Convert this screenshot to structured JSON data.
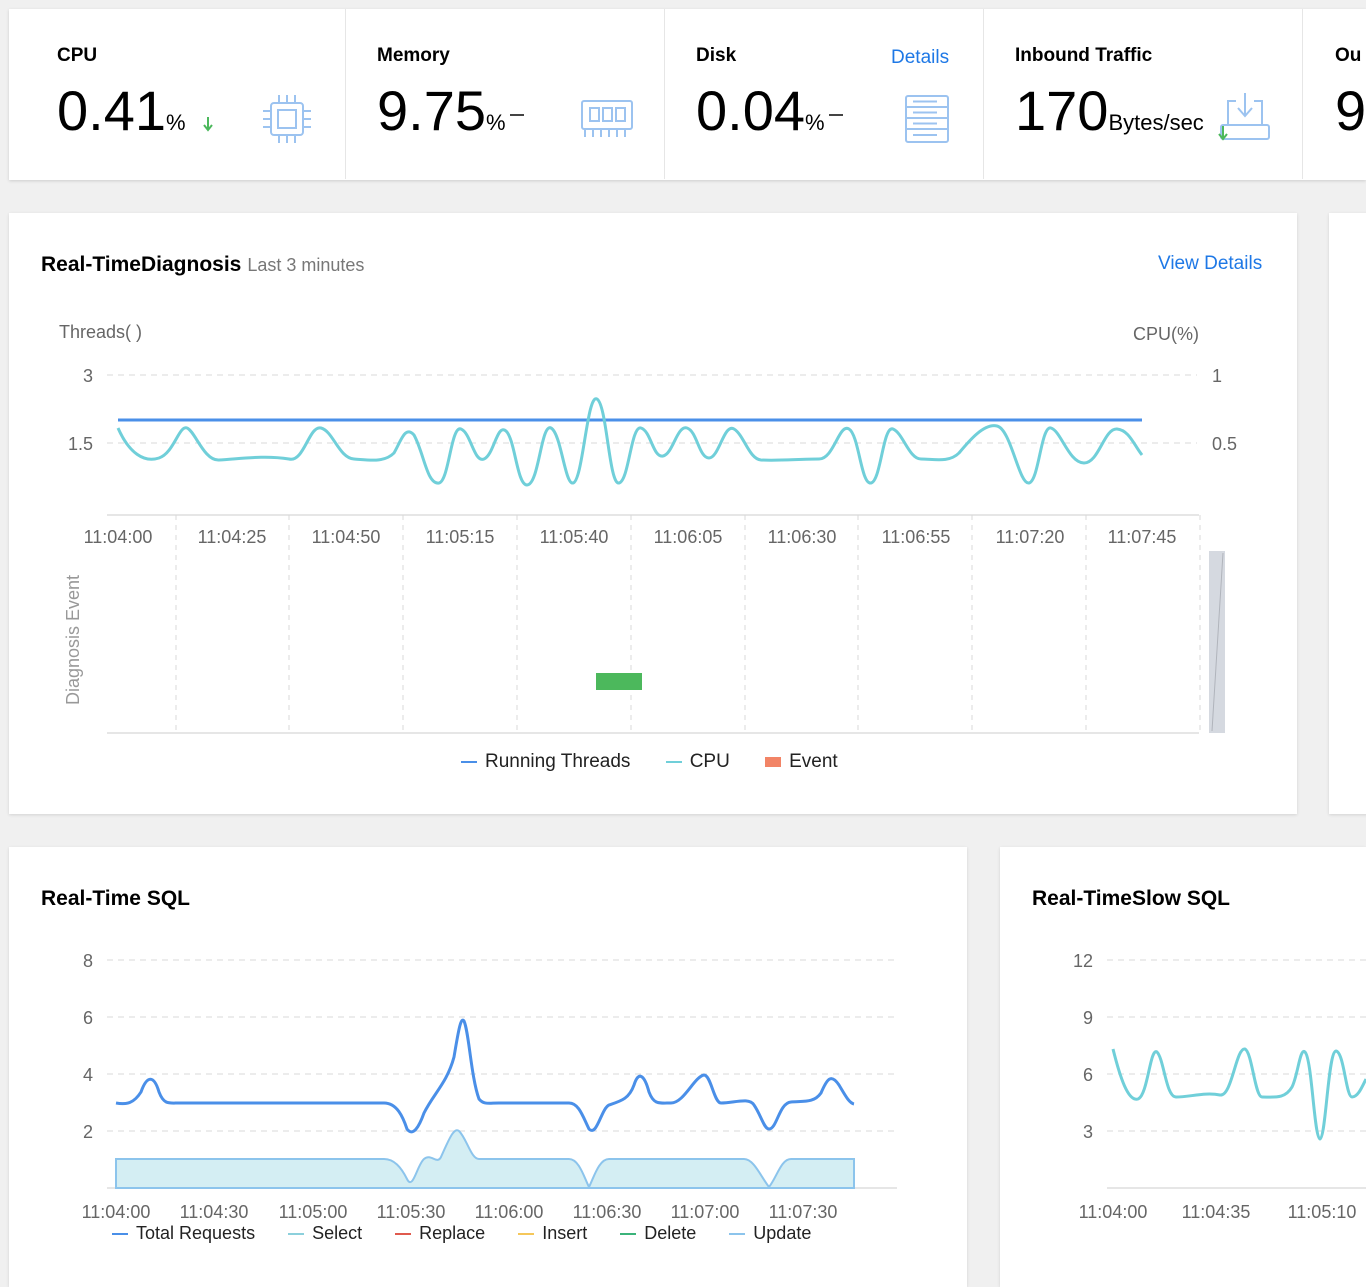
{
  "metrics": [
    {
      "title": "CPU",
      "value": "0.41",
      "unit": "%",
      "trend": "down",
      "icon": "cpu-icon"
    },
    {
      "title": "Memory",
      "value": "9.75",
      "unit": "%",
      "trend": "flat",
      "icon": "memory-icon"
    },
    {
      "title": "Disk",
      "value": "0.04",
      "unit": "%",
      "trend": "flat",
      "icon": "disk-icon",
      "link": "Details"
    },
    {
      "title": "Inbound Traffic",
      "value": "170",
      "unit": "Bytes/sec",
      "trend": "down",
      "icon": "inbound-traffic-icon"
    },
    {
      "title": "Ou",
      "value": "9"
    }
  ],
  "diagnosis": {
    "title": "Real-TimeDiagnosis",
    "subtitle": "Last 3 minutes",
    "view_details": "View Details",
    "y_left_label": "Threads( )",
    "y_right_label": "CPU(%)",
    "y_left_ticks": [
      "3",
      "1.5"
    ],
    "y_right_ticks": [
      "1",
      "0.5"
    ],
    "x_ticks": [
      "11:04:00",
      "11:04:25",
      "11:04:50",
      "11:05:15",
      "11:05:40",
      "11:06:05",
      "11:06:30",
      "11:06:55",
      "11:07:20",
      "11:07:45"
    ],
    "event_axis_label": "Diagnosis Event",
    "legend": [
      "Running Threads",
      "CPU",
      "Event"
    ]
  },
  "sql": {
    "title": "Real-Time SQL",
    "y_ticks": [
      "8",
      "6",
      "4",
      "2"
    ],
    "x_ticks": [
      "11:04:00",
      "11:04:30",
      "11:05:00",
      "11:05:30",
      "11:06:00",
      "11:06:30",
      "11:07:00",
      "11:07:30"
    ],
    "legend": [
      "Total Requests",
      "Select",
      "Replace",
      "Insert",
      "Delete",
      "Update"
    ]
  },
  "slow": {
    "title": "Real-TimeSlow SQL",
    "y_ticks": [
      "12",
      "9",
      "6",
      "3"
    ],
    "x_ticks": [
      "11:04:00",
      "11:04:35",
      "11:05:10"
    ]
  },
  "colors": {
    "blue": "#4a8fe8",
    "cyan": "#70cfd9",
    "green": "#4cb85c",
    "event": "#f28466",
    "red": "#e05a4e",
    "yellow": "#f5c75a",
    "darkgreen": "#3bb37a",
    "lightblue": "#8cc4ec",
    "link": "#1e78e6"
  },
  "chart_data": [
    {
      "type": "line",
      "title": "Real-TimeDiagnosis",
      "x": [
        "11:04:00",
        "11:04:25",
        "11:04:50",
        "11:05:15",
        "11:05:40",
        "11:06:05",
        "11:06:30",
        "11:06:55",
        "11:07:20",
        "11:07:45"
      ],
      "series": [
        {
          "name": "Running Threads",
          "axis": "left",
          "values": [
            2,
            2,
            2,
            2,
            2,
            2,
            2,
            2,
            2,
            2
          ]
        },
        {
          "name": "CPU",
          "axis": "right",
          "values": [
            0.45,
            0.42,
            0.43,
            0.35,
            0.78,
            0.44,
            0.42,
            0.35,
            0.6,
            0.45
          ]
        }
      ],
      "ylim_left": [
        0,
        3
      ],
      "ylim_right": [
        0,
        1
      ],
      "events": [
        {
          "name": "Event",
          "x_start": "11:05:40",
          "x_end": "11:05:50"
        }
      ]
    },
    {
      "type": "line",
      "title": "Real-Time SQL",
      "x": [
        "11:04:00",
        "11:04:30",
        "11:05:00",
        "11:05:30",
        "11:06:00",
        "11:06:30",
        "11:07:00",
        "11:07:30"
      ],
      "series": [
        {
          "name": "Total Requests",
          "values": [
            3,
            3,
            3,
            3,
            3,
            2,
            3,
            3
          ]
        },
        {
          "name": "Select",
          "values": [
            1,
            1,
            1,
            1,
            1,
            0,
            1,
            1
          ]
        },
        {
          "name": "Replace",
          "values": [
            0,
            0,
            0,
            0,
            0,
            0,
            0,
            0
          ]
        },
        {
          "name": "Insert",
          "values": [
            0,
            0,
            0,
            0,
            0,
            0,
            0,
            0
          ]
        },
        {
          "name": "Delete",
          "values": [
            0,
            0,
            0,
            0,
            0,
            0,
            0,
            0
          ]
        },
        {
          "name": "Update",
          "values": [
            0,
            0,
            0,
            0,
            0,
            0,
            0,
            0
          ]
        }
      ],
      "ylim": [
        0,
        8
      ]
    },
    {
      "type": "line",
      "title": "Real-TimeSlow SQL",
      "x": [
        "11:04:00",
        "11:04:35",
        "11:05:10"
      ],
      "series": [
        {
          "values": [
            5,
            5,
            5
          ]
        }
      ],
      "ylim": [
        0,
        12
      ]
    }
  ]
}
